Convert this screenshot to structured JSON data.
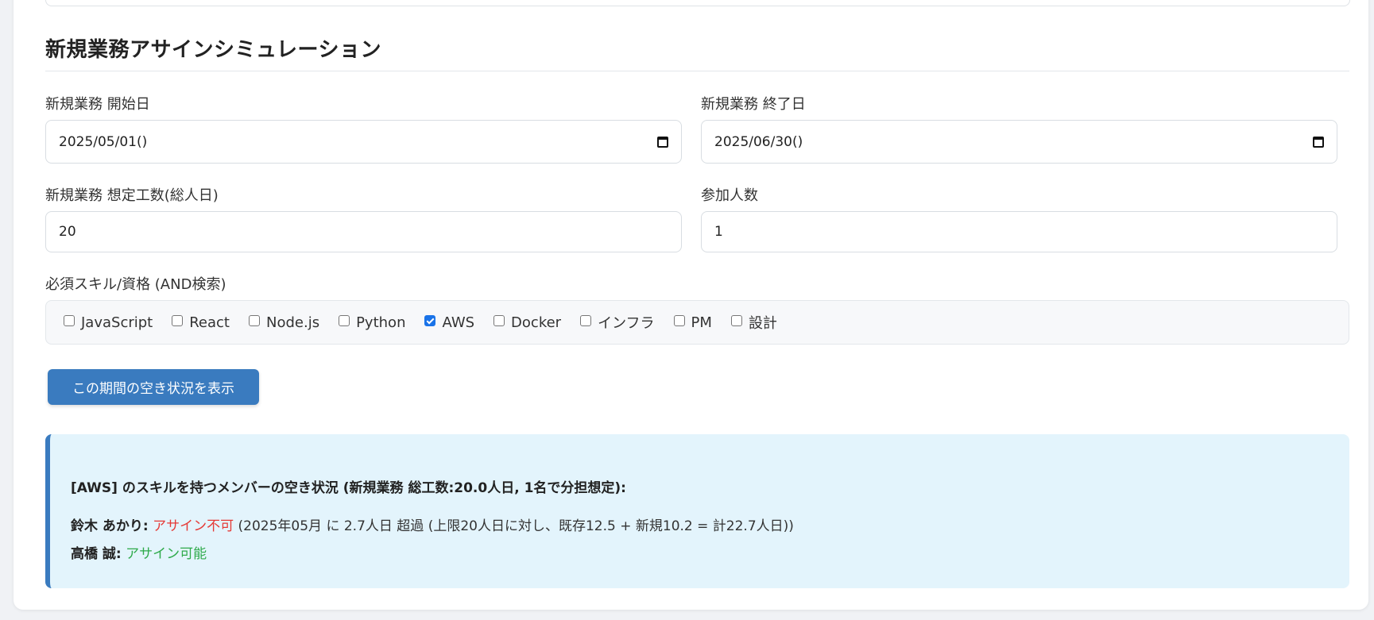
{
  "simulation": {
    "title": "新規業務アサインシミュレーション",
    "start_date": {
      "label": "新規業務 開始日",
      "value": "2025/05/01()"
    },
    "end_date": {
      "label": "新規業務 終了日",
      "value": "2025/06/30()"
    },
    "effort": {
      "label": "新規業務 想定工数(総人日)",
      "value": "20"
    },
    "participants": {
      "label": "参加人数",
      "value": "1"
    },
    "skills": {
      "label": "必須スキル/資格 (AND検索)",
      "options": [
        {
          "label": "JavaScript",
          "checked": false
        },
        {
          "label": "React",
          "checked": false
        },
        {
          "label": "Node.js",
          "checked": false
        },
        {
          "label": "Python",
          "checked": false
        },
        {
          "label": "AWS",
          "checked": true
        },
        {
          "label": "Docker",
          "checked": false
        },
        {
          "label": "インフラ",
          "checked": false
        },
        {
          "label": "PM",
          "checked": false
        },
        {
          "label": "設計",
          "checked": false
        }
      ]
    },
    "show_button_label": "この期間の空き状況を表示"
  },
  "result": {
    "heading": "[AWS] のスキルを持つメンバーの空き状況 (新規業務 総工数:20.0人日, 1名で分担想定):",
    "members": [
      {
        "name": "鈴木 あかり:",
        "status": "アサイン不可",
        "status_type": "ng",
        "detail": "(2025年05月 に 2.7人日 超過 (上限20人日に対し、既存12.5 + 新規10.2 = 計22.7人日))"
      },
      {
        "name": "高橋 誠:",
        "status": "アサイン可能",
        "status_type": "ok",
        "detail": ""
      }
    ]
  },
  "colors": {
    "accent": "#3a7bbf",
    "result_bg": "#e3f4fc",
    "status_ng": "#e53935",
    "status_ok": "#2eaa4a"
  },
  "icons": {
    "date_picker": "calendar-icon"
  }
}
